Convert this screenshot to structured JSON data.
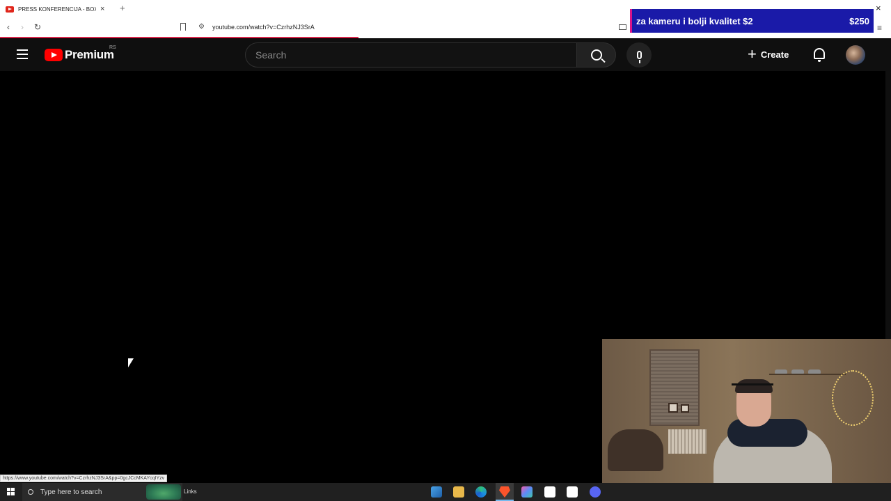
{
  "browser": {
    "tab_title": "PRESS KONFERENCIJA - BOX EV",
    "tab_close": "×",
    "new_tab": "+",
    "window_close": "×",
    "url": "youtube.com/watch?v=CzrhzNJ3SrA",
    "back": "‹",
    "forward": "›",
    "reload": "↻",
    "menu": "≡",
    "status_url": "https://www.youtube.com/watch?v=CzrhzNJ3SrA&pp=0gcJCcMKAYcqIYzv"
  },
  "donation": {
    "message": "za kameru i bolji kvalitet  $2",
    "amount": "$250"
  },
  "youtube": {
    "logo_text": "Premium",
    "region": "RS",
    "search_placeholder": "Search",
    "create_label": "Create",
    "create_plus": "+"
  },
  "taskbar": {
    "search_text": "Type here to search",
    "links_label": "Links",
    "icons": [
      "pinned-app-icon",
      "file-explorer-icon",
      "edge-icon",
      "brave-icon",
      "copilot-icon",
      "capcut-icon",
      "capcut-icon",
      "discord-icon"
    ]
  },
  "colors": {
    "youtube_red": "#ff0000",
    "donation_bg": "#1a1aa8",
    "donation_accent": "#d9138a",
    "loading_bar": "#d7264a"
  }
}
